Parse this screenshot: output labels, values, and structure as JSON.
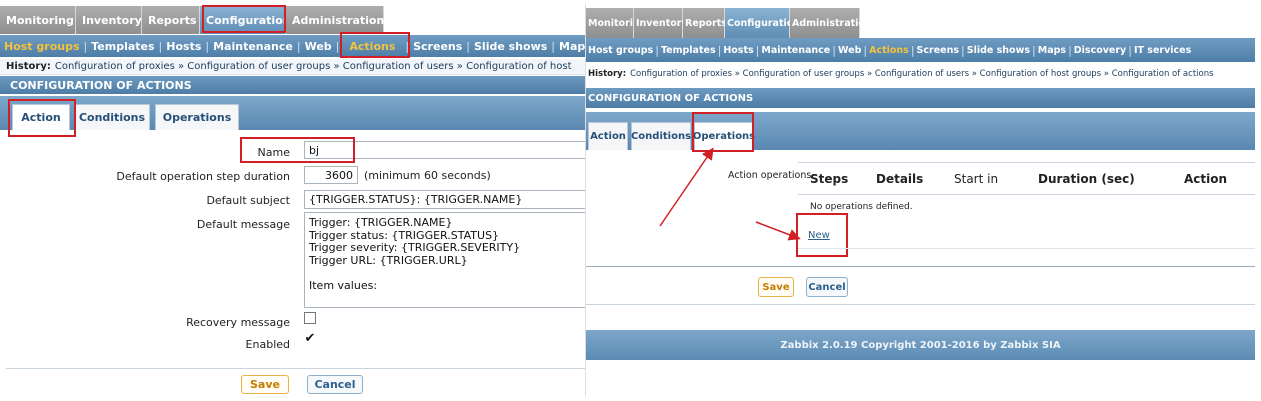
{
  "left": {
    "main_menu": [
      {
        "label": "Monitoring",
        "selected": false
      },
      {
        "label": "Inventory",
        "selected": false
      },
      {
        "label": "Reports",
        "selected": false
      },
      {
        "label": "Configuration",
        "selected": true
      },
      {
        "label": "Administration",
        "selected": false
      }
    ],
    "sub_menu": [
      {
        "label": "Host groups",
        "selected": true
      },
      {
        "label": "Templates",
        "selected": false
      },
      {
        "label": "Hosts",
        "selected": false
      },
      {
        "label": "Maintenance",
        "selected": false
      },
      {
        "label": "Web",
        "selected": false
      },
      {
        "label": "Actions",
        "selected": true
      },
      {
        "label": "Screens",
        "selected": false
      },
      {
        "label": "Slide shows",
        "selected": false
      },
      {
        "label": "Map",
        "selected": false
      }
    ],
    "history_label": "History:",
    "history_text": "Configuration of proxies » Configuration of user groups » Configuration of users » Configuration of host",
    "page_title": "CONFIGURATION OF ACTIONS",
    "tabs": [
      "Action",
      "Conditions",
      "Operations"
    ],
    "form": {
      "name_label": "Name",
      "name_value": "bj",
      "step_label": "Default operation step duration",
      "step_value": "3600",
      "step_note": "(minimum 60 seconds)",
      "subject_label": "Default subject",
      "subject_value": "{TRIGGER.STATUS}: {TRIGGER.NAME}",
      "message_label": "Default message",
      "message_value": "Trigger: {TRIGGER.NAME}\nTrigger status: {TRIGGER.STATUS}\nTrigger severity: {TRIGGER.SEVERITY}\nTrigger URL: {TRIGGER.URL}\n\nItem values:",
      "recovery_label": "Recovery message",
      "recovery_checked": "",
      "enabled_label": "Enabled",
      "enabled_checked": "✔"
    },
    "save_label": "Save",
    "cancel_label": "Cancel"
  },
  "right": {
    "main_menu": [
      {
        "label": "Monitoring",
        "selected": false
      },
      {
        "label": "Inventory",
        "selected": false
      },
      {
        "label": "Reports",
        "selected": false
      },
      {
        "label": "Configuration",
        "selected": true
      },
      {
        "label": "Administration",
        "selected": false
      }
    ],
    "sub_menu": [
      {
        "label": "Host groups",
        "selected": false
      },
      {
        "label": "Templates",
        "selected": false
      },
      {
        "label": "Hosts",
        "selected": false
      },
      {
        "label": "Maintenance",
        "selected": false
      },
      {
        "label": "Web",
        "selected": false
      },
      {
        "label": "Actions",
        "selected": true
      },
      {
        "label": "Screens",
        "selected": false
      },
      {
        "label": "Slide shows",
        "selected": false
      },
      {
        "label": "Maps",
        "selected": false
      },
      {
        "label": "Discovery",
        "selected": false
      },
      {
        "label": "IT services",
        "selected": false
      }
    ],
    "history_label": "History:",
    "history_text": "Configuration of proxies » Configuration of user groups » Configuration of users » Configuration of host groups » Configuration of actions",
    "page_title": "CONFIGURATION OF ACTIONS",
    "tabs": [
      "Action",
      "Conditions",
      "Operations"
    ],
    "operations": {
      "label": "Action operations",
      "columns": [
        "Steps",
        "Details",
        "Start in",
        "Duration (sec)",
        "Action"
      ],
      "empty_text": "No operations defined.",
      "new_link": "New"
    },
    "save_label": "Save",
    "cancel_label": "Cancel",
    "footer": "Zabbix 2.0.19 Copyright 2001-2016 by Zabbix SIA"
  },
  "colors": {
    "annotation_red": "#d21f26",
    "menu_selected": "#f4c23d",
    "header_blue": "#5a88b1"
  }
}
